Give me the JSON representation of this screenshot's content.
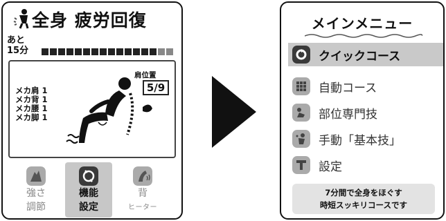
{
  "left_screen": {
    "course_title": "全身 疲労回復",
    "remaining_label": "あと",
    "remaining_time": "15分",
    "progress": {
      "completed_segments": 14,
      "total_segments": 16
    },
    "mechanism": [
      "メカ肩 1",
      "メカ背 1",
      "メカ腰 1",
      "メカ脚 1"
    ],
    "shoulder_position": {
      "label": "肩位置",
      "value": "5/9"
    },
    "functions": [
      {
        "line1": "強さ",
        "line2": "調節",
        "icon": "strength-icon",
        "active": false
      },
      {
        "line1": "機能",
        "line2": "設定",
        "icon": "function-settings-icon",
        "active": true
      },
      {
        "line1": "背",
        "line2": "ヒーター",
        "icon": "back-heater-icon",
        "active": false
      }
    ]
  },
  "right_screen": {
    "title": "メインメニュー",
    "menu_items": [
      {
        "label": "クイックコース",
        "icon": "quick-course-icon",
        "selected": true
      },
      {
        "label": "自動コース",
        "icon": "auto-course-icon",
        "selected": false
      },
      {
        "label": "部位専門技",
        "icon": "part-specialist-icon",
        "selected": false
      },
      {
        "label": "手動「基本技」",
        "icon": "manual-basic-icon",
        "selected": false
      },
      {
        "label": "設定",
        "icon": "settings-icon",
        "selected": false
      }
    ],
    "description_line1": "7分間で全身をほぐす",
    "description_line2": "時短スッキリコースです"
  },
  "colors": {
    "selected_bg": "#c9c9c9",
    "icon_dark": "#3a3a3a",
    "icon_dim": "#aaaaaa",
    "text": "#111111"
  }
}
